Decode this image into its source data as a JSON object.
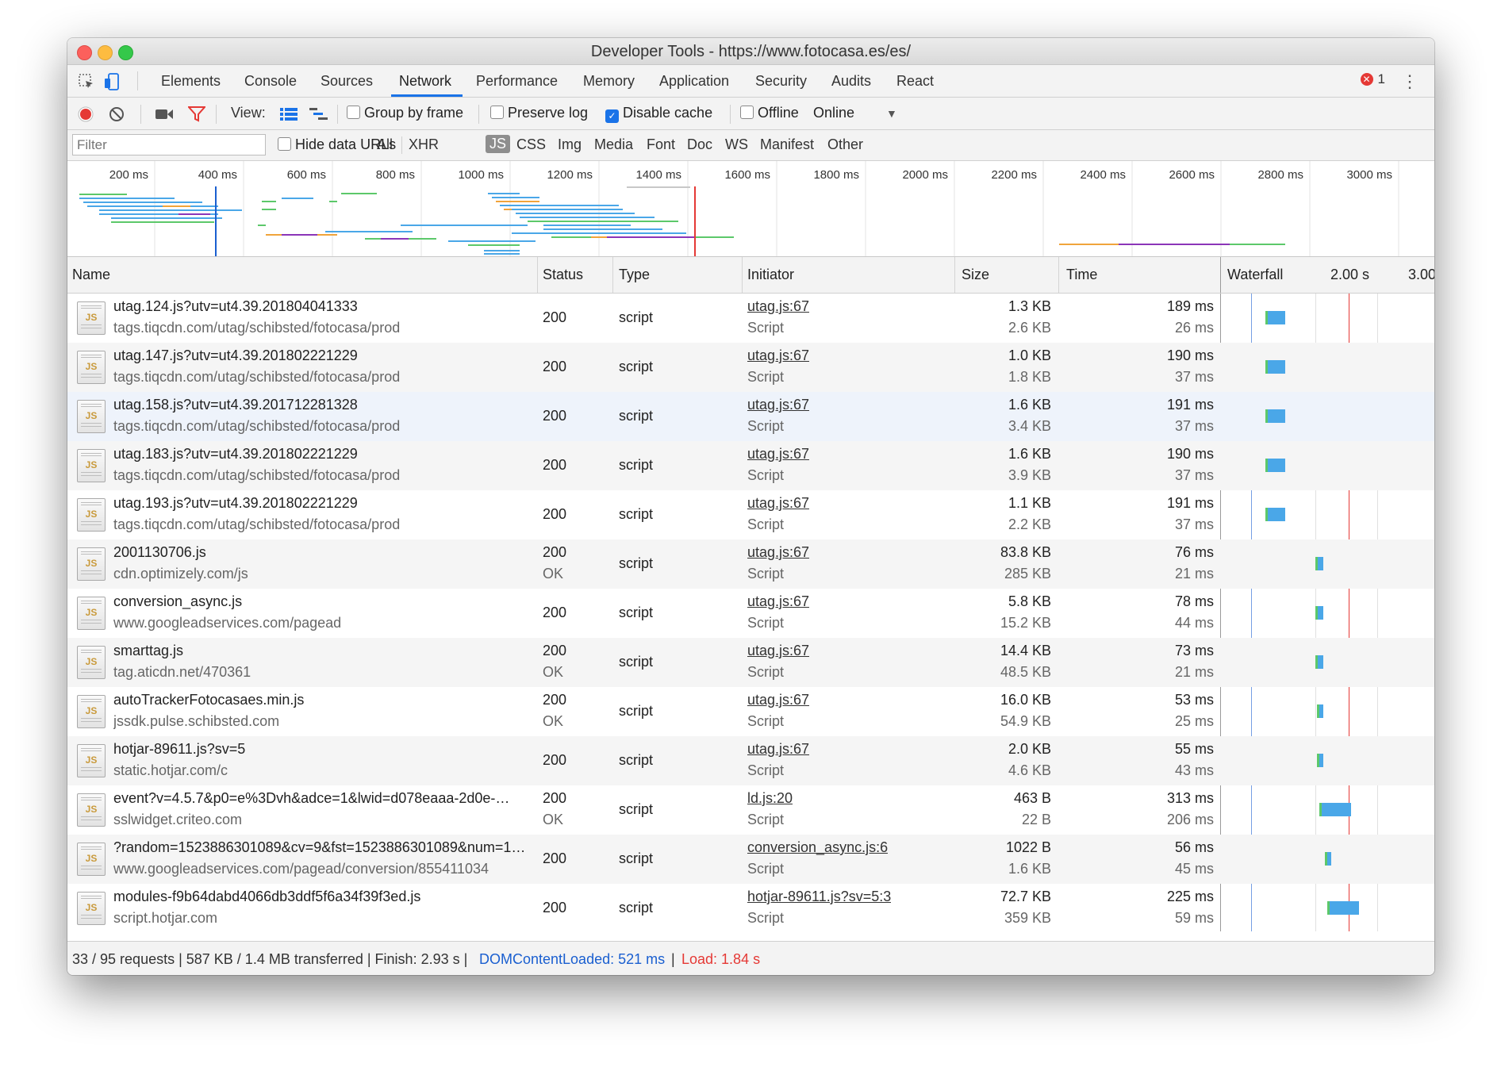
{
  "window": {
    "title": "Developer Tools - https://www.fotocasa.es/es/"
  },
  "tabs": [
    "Elements",
    "Console",
    "Sources",
    "Network",
    "Performance",
    "Memory",
    "Application",
    "Security",
    "Audits",
    "React"
  ],
  "active_tab": "Network",
  "error_count": "1",
  "toolbar": {
    "view_label": "View:",
    "group_by_frame": "Group by frame",
    "preserve_log": "Preserve log",
    "disable_cache": "Disable cache",
    "offline": "Offline",
    "throttle": "Online"
  },
  "filter": {
    "placeholder": "Filter",
    "hide_data_urls": "Hide data URLs",
    "types": [
      "All",
      "XHR",
      "JS",
      "CSS",
      "Img",
      "Media",
      "Font",
      "Doc",
      "WS",
      "Manifest",
      "Other"
    ],
    "active_type": "JS"
  },
  "overview": {
    "ticks": [
      "200 ms",
      "400 ms",
      "600 ms",
      "800 ms",
      "1000 ms",
      "1200 ms",
      "1400 ms",
      "1600 ms",
      "1800 ms",
      "2000 ms",
      "2200 ms",
      "2400 ms",
      "2600 ms",
      "2800 ms",
      "3000 ms"
    ]
  },
  "columns": {
    "name": "Name",
    "status": "Status",
    "type": "Type",
    "initiator": "Initiator",
    "size": "Size",
    "time": "Time",
    "waterfall": "Waterfall",
    "wf_tick1": "2.00 s",
    "wf_tick2": "3.00"
  },
  "rows": [
    {
      "name": "utag.124.js?utv=ut4.39.201804041333",
      "domain": "tags.tiqcdn.com/utag/schibsted/fotocasa/prod",
      "status": "200",
      "status_text": "",
      "type": "script",
      "initiator": "utag.js:67",
      "initiator_type": "Script",
      "size": "1.3 KB",
      "resource_size": "2.6 KB",
      "time": "189 ms",
      "latency": "26 ms",
      "wf": {
        "start": 0.2,
        "end": 0.3,
        "color": "#4aa7e8"
      }
    },
    {
      "name": "utag.147.js?utv=ut4.39.201802221229",
      "domain": "tags.tiqcdn.com/utag/schibsted/fotocasa/prod",
      "status": "200",
      "status_text": "",
      "type": "script",
      "initiator": "utag.js:67",
      "initiator_type": "Script",
      "size": "1.0 KB",
      "resource_size": "1.8 KB",
      "time": "190 ms",
      "latency": "37 ms",
      "wf": {
        "start": 0.2,
        "end": 0.3,
        "color": "#4aa7e8"
      }
    },
    {
      "name": "utag.158.js?utv=ut4.39.201712281328",
      "domain": "tags.tiqcdn.com/utag/schibsted/fotocasa/prod",
      "status": "200",
      "status_text": "",
      "type": "script",
      "initiator": "utag.js:67",
      "initiator_type": "Script",
      "size": "1.6 KB",
      "resource_size": "3.4 KB",
      "time": "191 ms",
      "latency": "37 ms",
      "wf": {
        "start": 0.2,
        "end": 0.3,
        "color": "#4aa7e8"
      }
    },
    {
      "name": "utag.183.js?utv=ut4.39.201802221229",
      "domain": "tags.tiqcdn.com/utag/schibsted/fotocasa/prod",
      "status": "200",
      "status_text": "",
      "type": "script",
      "initiator": "utag.js:67",
      "initiator_type": "Script",
      "size": "1.6 KB",
      "resource_size": "3.9 KB",
      "time": "190 ms",
      "latency": "37 ms",
      "wf": {
        "start": 0.2,
        "end": 0.3,
        "color": "#4aa7e8"
      }
    },
    {
      "name": "utag.193.js?utv=ut4.39.201802221229",
      "domain": "tags.tiqcdn.com/utag/schibsted/fotocasa/prod",
      "status": "200",
      "status_text": "",
      "type": "script",
      "initiator": "utag.js:67",
      "initiator_type": "Script",
      "size": "1.1 KB",
      "resource_size": "2.2 KB",
      "time": "191 ms",
      "latency": "37 ms",
      "wf": {
        "start": 0.2,
        "end": 0.3,
        "color": "#4aa7e8"
      }
    },
    {
      "name": "2001130706.js",
      "domain": "cdn.optimizely.com/js",
      "status": "200",
      "status_text": "OK",
      "type": "script",
      "initiator": "utag.js:67",
      "initiator_type": "Script",
      "size": "83.8 KB",
      "resource_size": "285 KB",
      "time": "76 ms",
      "latency": "21 ms",
      "wf": {
        "start": 0.45,
        "end": 0.49,
        "color": "#4aa7e8"
      }
    },
    {
      "name": "conversion_async.js",
      "domain": "www.googleadservices.com/pagead",
      "status": "200",
      "status_text": "",
      "type": "script",
      "initiator": "utag.js:67",
      "initiator_type": "Script",
      "size": "5.8 KB",
      "resource_size": "15.2 KB",
      "time": "78 ms",
      "latency": "44 ms",
      "wf": {
        "start": 0.45,
        "end": 0.49,
        "color": "#4aa7e8"
      }
    },
    {
      "name": "smarttag.js",
      "domain": "tag.aticdn.net/470361",
      "status": "200",
      "status_text": "OK",
      "type": "script",
      "initiator": "utag.js:67",
      "initiator_type": "Script",
      "size": "14.4 KB",
      "resource_size": "48.5 KB",
      "time": "73 ms",
      "latency": "21 ms",
      "wf": {
        "start": 0.45,
        "end": 0.49,
        "color": "#4aa7e8"
      }
    },
    {
      "name": "autoTrackerFotocasaes.min.js",
      "domain": "jssdk.pulse.schibsted.com",
      "status": "200",
      "status_text": "OK",
      "type": "script",
      "initiator": "utag.js:67",
      "initiator_type": "Script",
      "size": "16.0 KB",
      "resource_size": "54.9 KB",
      "time": "53 ms",
      "latency": "25 ms",
      "wf": {
        "start": 0.46,
        "end": 0.49,
        "color": "#4aa7e8"
      }
    },
    {
      "name": "hotjar-89611.js?sv=5",
      "domain": "static.hotjar.com/c",
      "status": "200",
      "status_text": "",
      "type": "script",
      "initiator": "utag.js:67",
      "initiator_type": "Script",
      "size": "2.0 KB",
      "resource_size": "4.6 KB",
      "time": "55 ms",
      "latency": "43 ms",
      "wf": {
        "start": 0.46,
        "end": 0.49,
        "color": "#4aa7e8"
      }
    },
    {
      "name": "event?v=4.5.7&p0=e%3Dvh&adce=1&lwid=d078eaaa-2d0e-…",
      "domain": "sslwidget.criteo.com",
      "status": "200",
      "status_text": "OK",
      "type": "script",
      "initiator": "ld.js:20",
      "initiator_type": "Script",
      "size": "463 B",
      "resource_size": "22 B",
      "time": "313 ms",
      "latency": "206 ms",
      "wf": {
        "start": 0.47,
        "end": 0.63,
        "color": "#4aa7e8"
      }
    },
    {
      "name": "?random=1523886301089&cv=9&fst=1523886301089&num=1…",
      "domain": "www.googleadservices.com/pagead/conversion/855411034",
      "status": "200",
      "status_text": "",
      "type": "script",
      "initiator": "conversion_async.js:6",
      "initiator_type": "Script",
      "size": "1022 B",
      "resource_size": "1.6 KB",
      "time": "56 ms",
      "latency": "45 ms",
      "wf": {
        "start": 0.5,
        "end": 0.53,
        "color": "#4aa7e8"
      }
    },
    {
      "name": "modules-f9b64dabd4066db3ddf5f6a34f39f3ed.js",
      "domain": "script.hotjar.com",
      "status": "200",
      "status_text": "",
      "type": "script",
      "initiator": "hotjar-89611.js?sv=5:3",
      "initiator_type": "Script",
      "size": "72.7 KB",
      "resource_size": "359 KB",
      "time": "225 ms",
      "latency": "59 ms",
      "wf": {
        "start": 0.51,
        "end": 0.67,
        "color": "#4aa7e8"
      }
    }
  ],
  "statusbar": {
    "summary": "33 / 95 requests | 587 KB / 1.4 MB transferred | Finish: 2.93 s |",
    "domcontentloaded": "DOMContentLoaded: 521 ms",
    "load": "Load: 1.84 s",
    "divider": "|"
  },
  "colors": {
    "accent": "#1a73e8",
    "record": "#e53935",
    "dcl_line": "#1a5fd0",
    "load_line": "#e53935",
    "bar_blue": "#4aa7e8",
    "bar_green": "#5cc86a",
    "bar_orange": "#f0a43b",
    "bar_purple": "#8b35b8"
  }
}
